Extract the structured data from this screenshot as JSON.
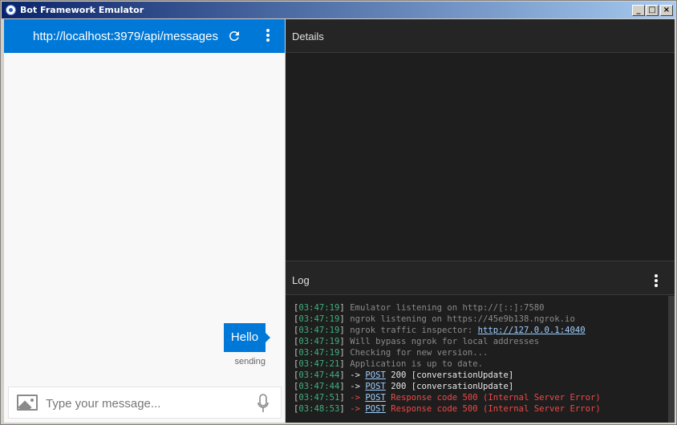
{
  "window": {
    "title": "Bot Framework Emulator",
    "minimize": "_",
    "maximize": "□",
    "close": "×"
  },
  "chat": {
    "url": "http://localhost:3979/api/messages",
    "message": "Hello",
    "message_status": "sending",
    "input_placeholder": "Type your message..."
  },
  "details": {
    "title": "Details"
  },
  "log": {
    "title": "Log",
    "lines": [
      {
        "ts": "03:47:19",
        "parts": [
          {
            "t": "Emulator listening on http://[::]:7580"
          }
        ]
      },
      {
        "ts": "03:47:19",
        "parts": [
          {
            "t": "ngrok listening on https://45e9b138.ngrok.io"
          }
        ]
      },
      {
        "ts": "03:47:19",
        "parts": [
          {
            "t": "ngrok traffic inspector: "
          },
          {
            "t": "http://127.0.0.1:4040",
            "link": true
          }
        ]
      },
      {
        "ts": "03:47:19",
        "parts": [
          {
            "t": "Will bypass ngrok for local addresses"
          }
        ]
      },
      {
        "ts": "03:47:19",
        "parts": [
          {
            "t": "Checking for new version..."
          }
        ]
      },
      {
        "ts": "03:47:21",
        "parts": [
          {
            "t": "Application is up to date."
          }
        ]
      },
      {
        "ts": "03:47:44",
        "style": "white",
        "parts": [
          {
            "t": "-> "
          },
          {
            "t": "POST",
            "post": true
          },
          {
            "t": " 200 [conversationUpdate]"
          }
        ]
      },
      {
        "ts": "03:47:44",
        "style": "white",
        "parts": [
          {
            "t": "-> "
          },
          {
            "t": "POST",
            "post": true
          },
          {
            "t": " 200 [conversationUpdate]"
          }
        ]
      },
      {
        "ts": "03:47:51",
        "style": "red",
        "parts": [
          {
            "t": "-> "
          },
          {
            "t": "POST",
            "post": true
          },
          {
            "t": " Response code 500 (Internal Server Error)"
          }
        ]
      },
      {
        "ts": "03:48:53",
        "style": "red",
        "parts": [
          {
            "t": "-> "
          },
          {
            "t": "POST",
            "post": true
          },
          {
            "t": " Response code 500 (Internal Server Error)"
          }
        ]
      }
    ]
  },
  "colors": {
    "accent": "#0078d7",
    "timestamp": "#3fb07c",
    "error": "#f04848",
    "panel": "#1e1e1e"
  },
  "icons": [
    "app-icon",
    "refresh-icon",
    "more-vertical-icon",
    "image-icon",
    "microphone-icon"
  ]
}
